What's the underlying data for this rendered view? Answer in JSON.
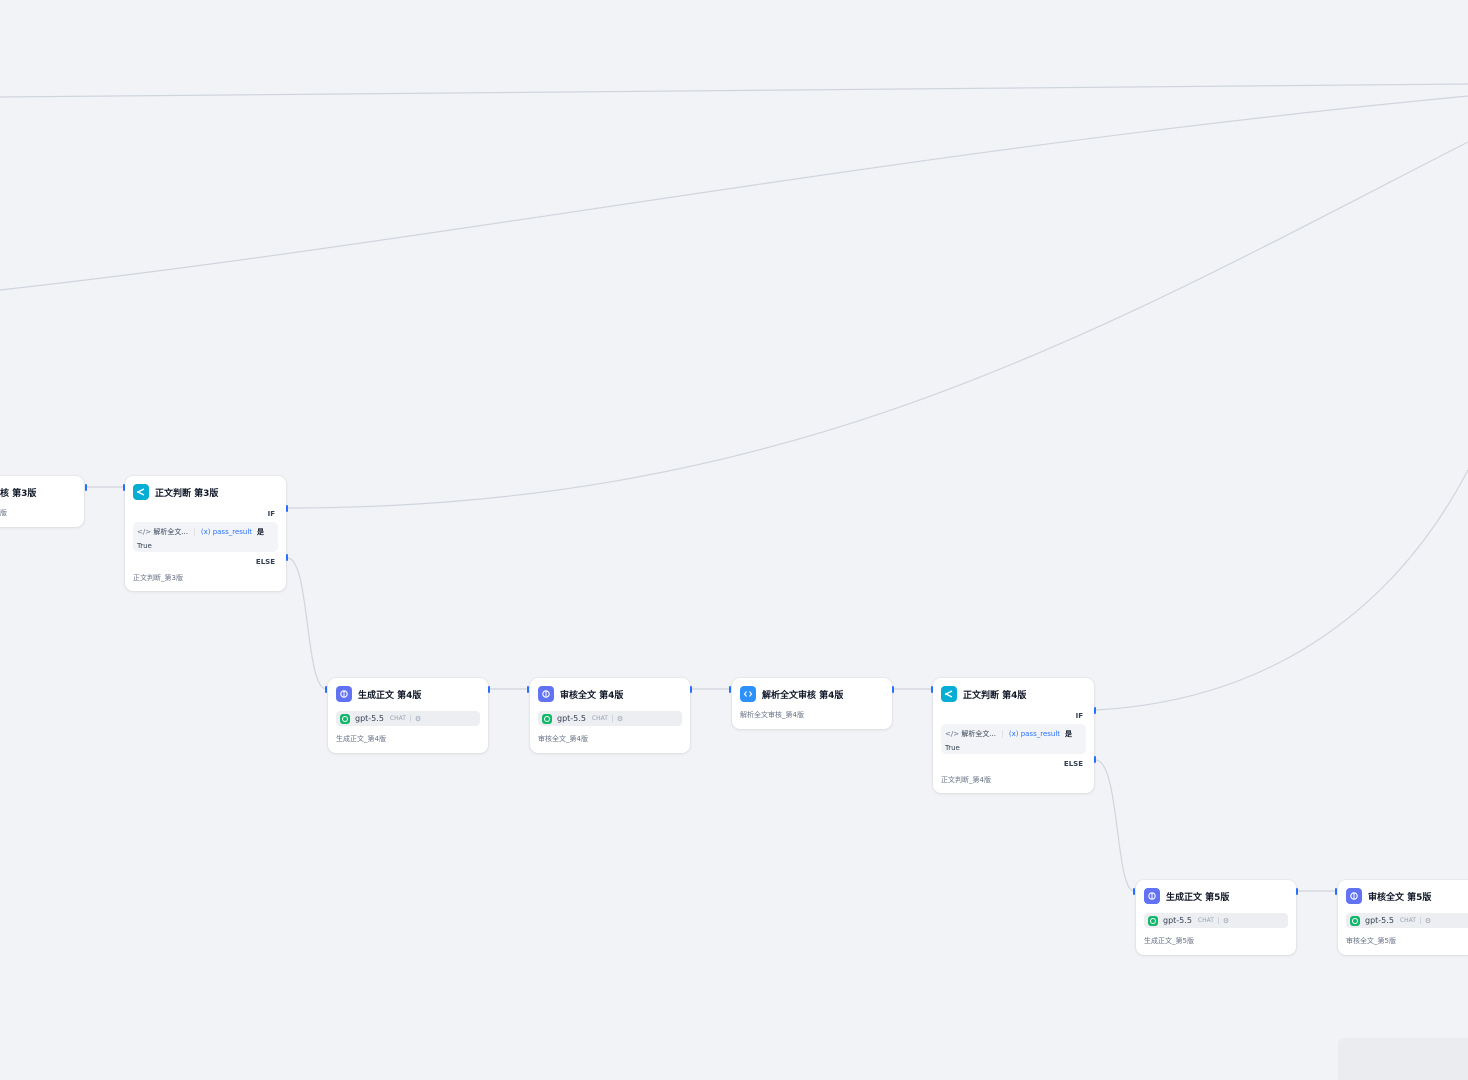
{
  "nodes": {
    "audit3_partial": {
      "title": "核 第3版",
      "desc": "版"
    },
    "judge3": {
      "title": "正文判断 第3版",
      "if_label": "IF",
      "cond_source": "解析全文...",
      "cond_var": "pass_result",
      "cond_op": "是",
      "cond_value": "True",
      "else_label": "ELSE",
      "desc": "正文判断_第3版"
    },
    "gen4": {
      "title": "生成正文 第4版",
      "model": "gpt-5.5",
      "mode": "CHAT",
      "desc": "生成正文_第4版"
    },
    "audit4": {
      "title": "审核全文 第4版",
      "model": "gpt-5.5",
      "mode": "CHAT",
      "desc": "审核全文_第4版"
    },
    "parse4": {
      "title": "解析全文审核 第4版",
      "desc": "解析全文审核_第4版"
    },
    "judge4": {
      "title": "正文判断 第4版",
      "if_label": "IF",
      "cond_source": "解析全文...",
      "cond_var": "pass_result",
      "cond_op": "是",
      "cond_value": "True",
      "else_label": "ELSE",
      "desc": "正文判断_第4版"
    },
    "gen5": {
      "title": "生成正文 第5版",
      "model": "gpt-5.5",
      "mode": "CHAT",
      "desc": "生成正文_第5版"
    },
    "audit5": {
      "title": "审核全文 第5版",
      "model": "gpt-5.5",
      "mode": "CHAT",
      "desc": "审核全文_第5版"
    }
  },
  "colors": {
    "canvas": "#f2f3f6",
    "edge": "#d0d5dd",
    "handle": "#2970ff",
    "llm_icon": "#6172f3",
    "code_icon": "#2e90fa",
    "ifelse_icon": "#06aed4",
    "model_icon": "#12b76a"
  },
  "icons": {
    "llm": "brain-icon",
    "code": "code-icon",
    "ifelse": "branch-icon",
    "model": "openai-icon",
    "model_settings": "settings-icon"
  }
}
